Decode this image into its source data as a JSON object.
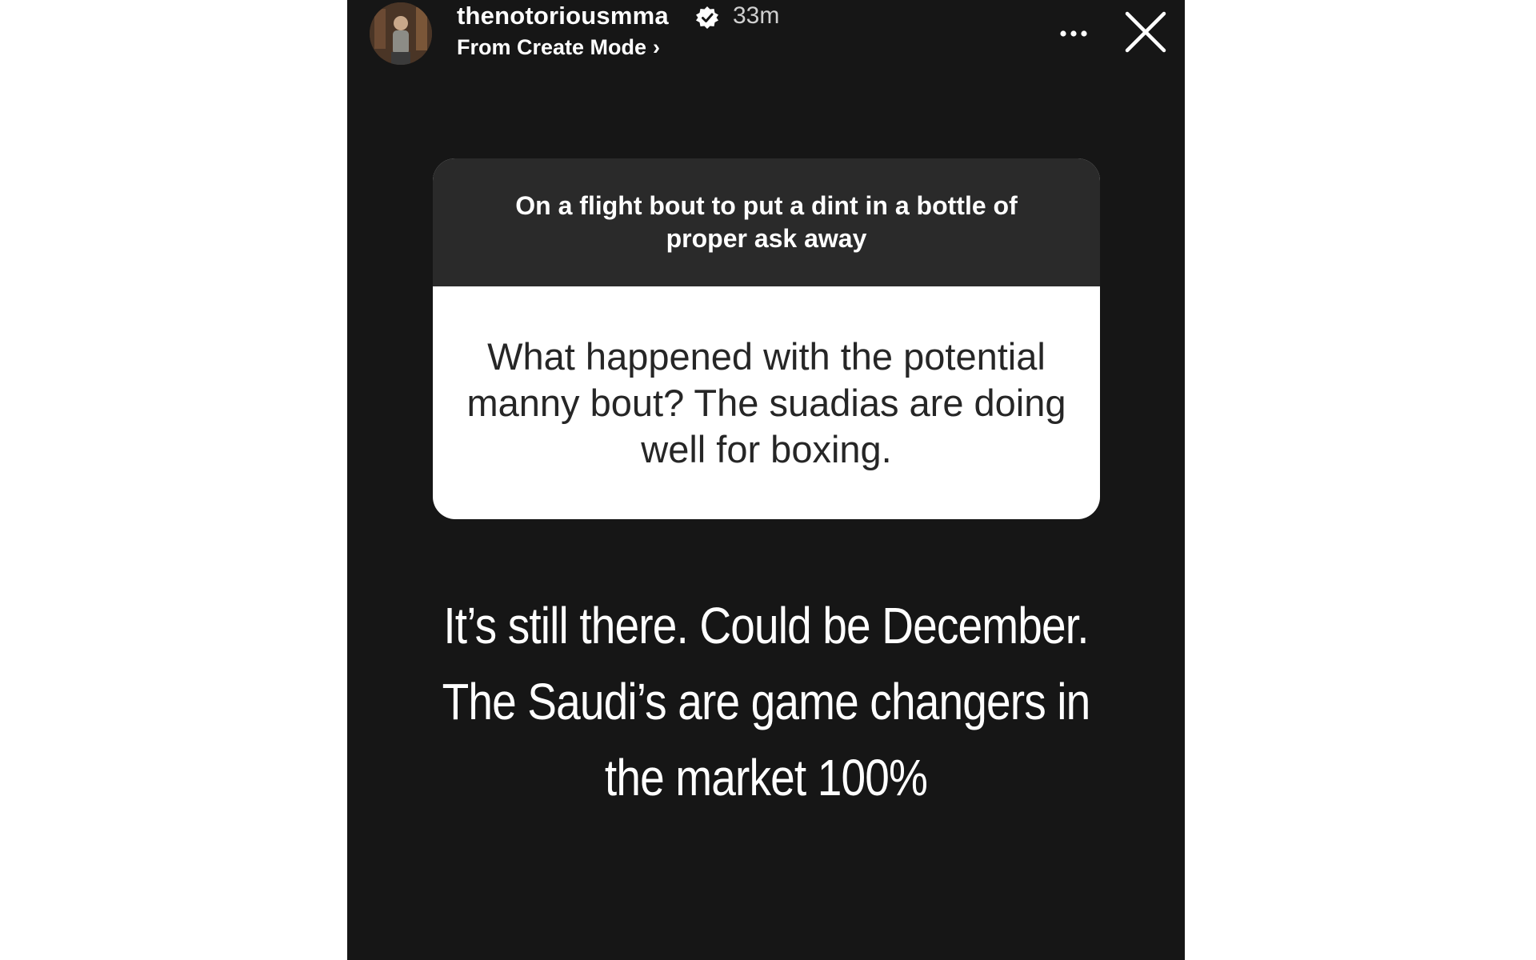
{
  "story": {
    "username": "thenotoriousmma",
    "timestamp": "33m",
    "source_label": "From Create Mode",
    "source_chevron": "›",
    "icons": {
      "verified": "verified-badge-icon",
      "more": "more-options-icon",
      "close": "close-icon"
    }
  },
  "question_sticker": {
    "prompt": "On a flight bout to put a dint in a bottle of proper ask away",
    "question": "What happened with the potential manny bout? The suadias are doing well for boxing."
  },
  "answer": {
    "text": "It’s still there. Could be December. The Saudi’s are game changers in the market 100%"
  },
  "colors": {
    "story_background": "#161616",
    "sticker_header": "#2a2a2a",
    "sticker_body": "#ffffff",
    "text_primary": "#ffffff",
    "question_text": "#262626"
  }
}
